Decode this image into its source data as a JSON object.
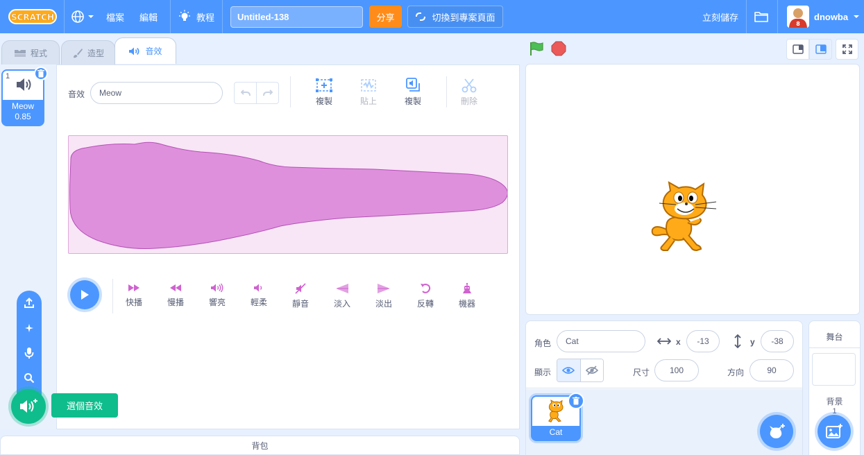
{
  "menubar": {
    "logo": "SCRATCH",
    "file": "檔案",
    "edit": "編輯",
    "tutorials": "教程",
    "project_title": "Untitled-138",
    "share": "分享",
    "see_project_page": "切換到專案頁面",
    "save_now": "立刻儲存",
    "username": "dnowba"
  },
  "tabs": [
    {
      "label": "程式"
    },
    {
      "label": "造型"
    },
    {
      "label": "音效"
    }
  ],
  "sound_list": {
    "items": [
      {
        "index": "1",
        "name": "Meow",
        "duration": "0.85"
      }
    ]
  },
  "editor": {
    "sound_label": "音效",
    "sound_name": "Meow",
    "tools": {
      "copy": "複製",
      "paste": "貼上",
      "copy_to_new": "複製",
      "delete": "刪除"
    },
    "effects": [
      {
        "label": "快播",
        "icon": "faster-icon"
      },
      {
        "label": "慢播",
        "icon": "slower-icon"
      },
      {
        "label": "響亮",
        "icon": "louder-icon"
      },
      {
        "label": "輕柔",
        "icon": "softer-icon"
      },
      {
        "label": "靜音",
        "icon": "mute-icon"
      },
      {
        "label": "淡入",
        "icon": "fade-in-icon"
      },
      {
        "label": "淡出",
        "icon": "fade-out-icon"
      },
      {
        "label": "反轉",
        "icon": "reverse-icon"
      },
      {
        "label": "機器",
        "icon": "robot-icon"
      }
    ]
  },
  "add_sound": {
    "tooltip": "選個音效"
  },
  "backpack": {
    "label": "背包"
  },
  "sprite_info": {
    "sprite_label": "角色",
    "sprite_name": "Cat",
    "x_label": "x",
    "x_value": "-13",
    "y_label": "y",
    "y_value": "-38",
    "show_label": "顯示",
    "size_label": "尺寸",
    "size_value": "100",
    "direction_label": "方向",
    "direction_value": "90"
  },
  "sprites": [
    {
      "name": "Cat"
    }
  ],
  "stage_pane": {
    "title": "舞台",
    "backdrops_label": "背景",
    "backdrop_count": "1"
  },
  "colors": {
    "primary": "#4c97ff",
    "orange": "#ff8c1a",
    "green": "#0fbd8c",
    "wave": "#cf63cf"
  }
}
